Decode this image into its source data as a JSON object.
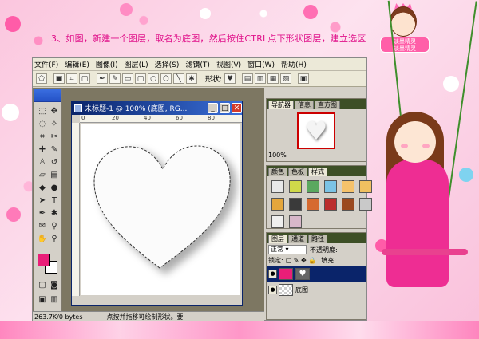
{
  "instruction": "3、如图，新建一个图层，取名为底图，然后按住CTRL点下形状图层，建立选区",
  "logo": {
    "text_line1": "淡墨精灵",
    "text_line2": "淡墨精灵"
  },
  "menu": [
    "文件(F)",
    "编辑(E)",
    "图像(I)",
    "图层(L)",
    "选择(S)",
    "滤镜(T)",
    "视图(V)",
    "窗口(W)",
    "帮助(H)"
  ],
  "options_bar": {
    "shape_label": "形状:"
  },
  "document": {
    "title": "未标题-1 @ 100% (底图, RG...",
    "ruler_marks": [
      "0",
      "20",
      "40",
      "60",
      "80"
    ],
    "status": "263.7K/0 bytes",
    "hint": "点按并拖移可绘制形状。要"
  },
  "navigator_panel": {
    "tabs": [
      "导航器",
      "信息",
      "直方图"
    ],
    "zoom": "100%"
  },
  "styles_panel": {
    "tabs": [
      "颜色",
      "色板",
      "样式"
    ]
  },
  "layers_panel": {
    "tabs": [
      "图层",
      "通道",
      "路径"
    ],
    "blend_mode": "正常",
    "opacity_label": "不透明度:",
    "lock_label": "锁定:",
    "fill_label": "填充:",
    "layers": [
      {
        "name": "",
        "selected": true
      },
      {
        "name": "底图",
        "selected": false
      }
    ]
  },
  "colors": {
    "foreground": "#e91e78",
    "background": "#ffffff",
    "accent": "#e0118a"
  }
}
